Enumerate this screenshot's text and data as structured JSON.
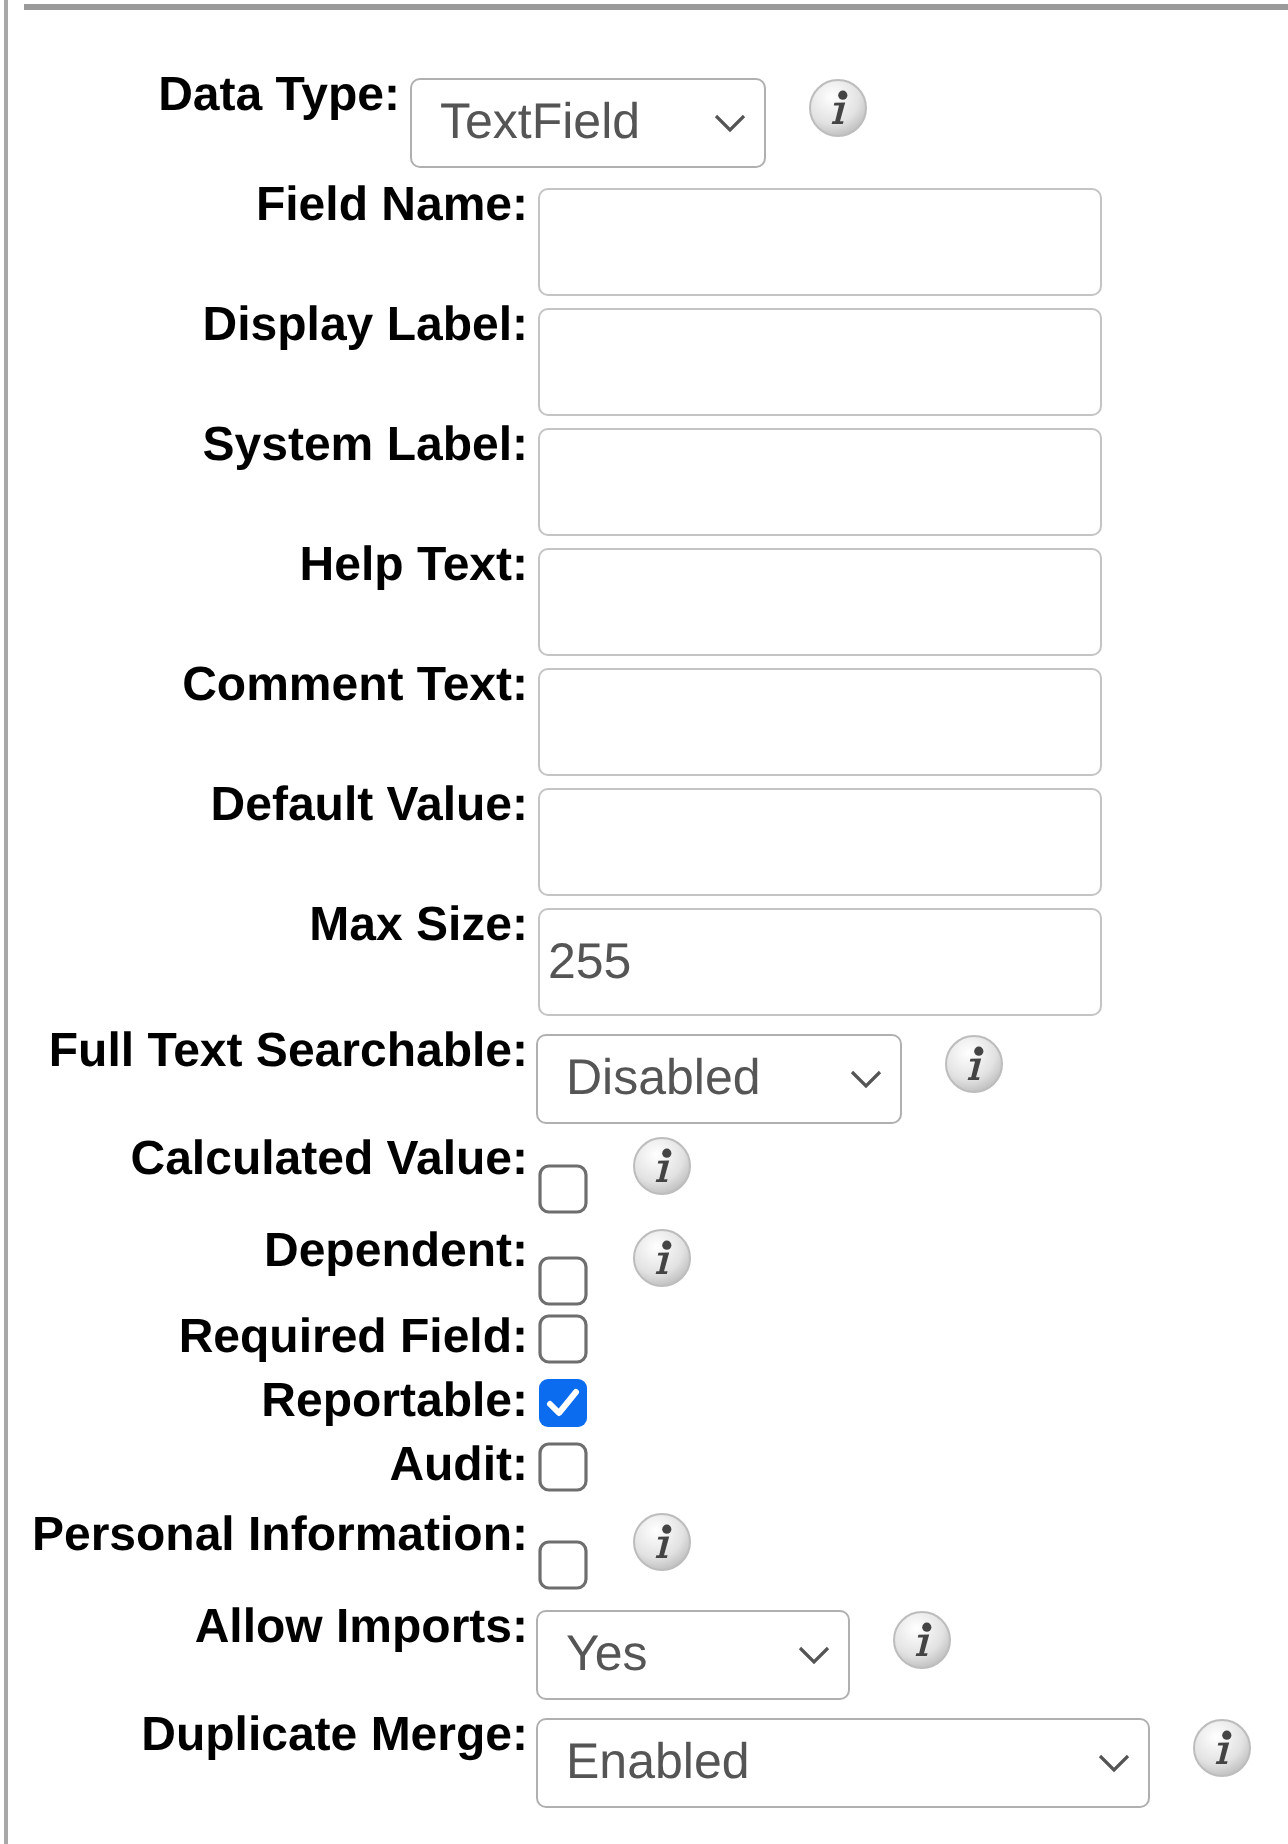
{
  "data_type": {
    "label": "Data Type:",
    "value": "TextField",
    "info": true
  },
  "fields": [
    {
      "kind": "text",
      "label": "Field Name:",
      "info": false
    },
    {
      "kind": "text",
      "label": "Display Label:",
      "info": false
    },
    {
      "kind": "text",
      "label": "System Label:",
      "info": false
    },
    {
      "kind": "text",
      "label": "Help Text:",
      "info": false
    },
    {
      "kind": "text",
      "label": "Comment Text:",
      "info": false
    },
    {
      "kind": "text",
      "label": "Default Value:",
      "info": false
    },
    {
      "kind": "text",
      "label": "Max Size:",
      "value": "255",
      "info": false
    },
    {
      "kind": "select",
      "label": "Full Text Searchable:",
      "value": "Disabled",
      "info": true
    },
    {
      "kind": "checkbox",
      "label": "Calculated Value:",
      "checked": false,
      "info": true
    },
    {
      "kind": "checkbox",
      "label": "Dependent:",
      "checked": false,
      "info": true
    },
    {
      "kind": "checkbox",
      "label": "Required Field:",
      "checked": false,
      "info": false
    },
    {
      "kind": "checkbox",
      "label": "Reportable:",
      "checked": true,
      "info": false
    },
    {
      "kind": "checkbox",
      "label": "Audit:",
      "checked": false,
      "info": false
    },
    {
      "kind": "checkbox",
      "label": "Personal Information:",
      "checked": false,
      "info": true
    },
    {
      "kind": "select",
      "label": "Allow Imports:",
      "value": "Yes",
      "info": true
    },
    {
      "kind": "select",
      "label": "Duplicate Merge:",
      "value": "Enabled",
      "info": true
    }
  ]
}
